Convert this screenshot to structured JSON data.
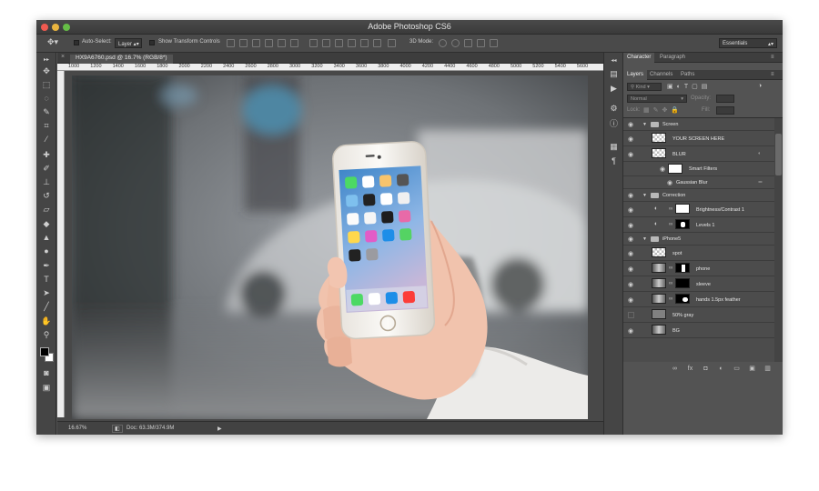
{
  "app": {
    "title": "Adobe Photoshop CS6"
  },
  "options_bar": {
    "auto_select_label": "Auto-Select:",
    "auto_select_value": "Layer",
    "transform_label": "Show Transform Controls",
    "mode_3d_label": "3D Mode:",
    "workspace_value": "Essentials"
  },
  "document": {
    "tab_label": "HX9A6760.psd @ 16.7% (RGB/8*)",
    "ruler_numbers": [
      "1000",
      "1200",
      "1400",
      "1600",
      "1800",
      "2000",
      "2200",
      "2400",
      "2600",
      "2800",
      "3000",
      "3200",
      "3400",
      "3600",
      "3800",
      "4000",
      "4200",
      "4400",
      "4600",
      "4800",
      "5000",
      "5200",
      "5400",
      "5600"
    ],
    "zoom": "16.67%",
    "doc_size": "Doc: 63.3M/374.9M"
  },
  "panels": {
    "top_tabs": [
      "Character",
      "Paragraph"
    ],
    "layers_tabs": [
      "Layers",
      "Channels",
      "Paths"
    ],
    "kind_label": "Kind",
    "blend_mode": "Normal",
    "opacity_label": "Opacity:",
    "lock_label": "Lock:",
    "fill_label": "Fill:"
  },
  "layers": [
    {
      "name": "Screen",
      "kind": "group"
    },
    {
      "name": "YOUR SCREEN HERE",
      "kind": "layer"
    },
    {
      "name": "BLUR",
      "kind": "smart"
    },
    {
      "name": "Smart Filters",
      "kind": "filter-header"
    },
    {
      "name": "Gaussian Blur",
      "kind": "filter"
    },
    {
      "name": "Correction",
      "kind": "group"
    },
    {
      "name": "Brightness/Contrast 1",
      "kind": "adjust"
    },
    {
      "name": "Levels 1",
      "kind": "adjust"
    },
    {
      "name": "iPhone5",
      "kind": "group"
    },
    {
      "name": "spot",
      "kind": "layer"
    },
    {
      "name": "phone",
      "kind": "masked"
    },
    {
      "name": "sleeve",
      "kind": "masked"
    },
    {
      "name": "hands 1.5px feather",
      "kind": "masked"
    },
    {
      "name": "50% gray",
      "kind": "gray"
    },
    {
      "name": "BG",
      "kind": "photo"
    }
  ]
}
